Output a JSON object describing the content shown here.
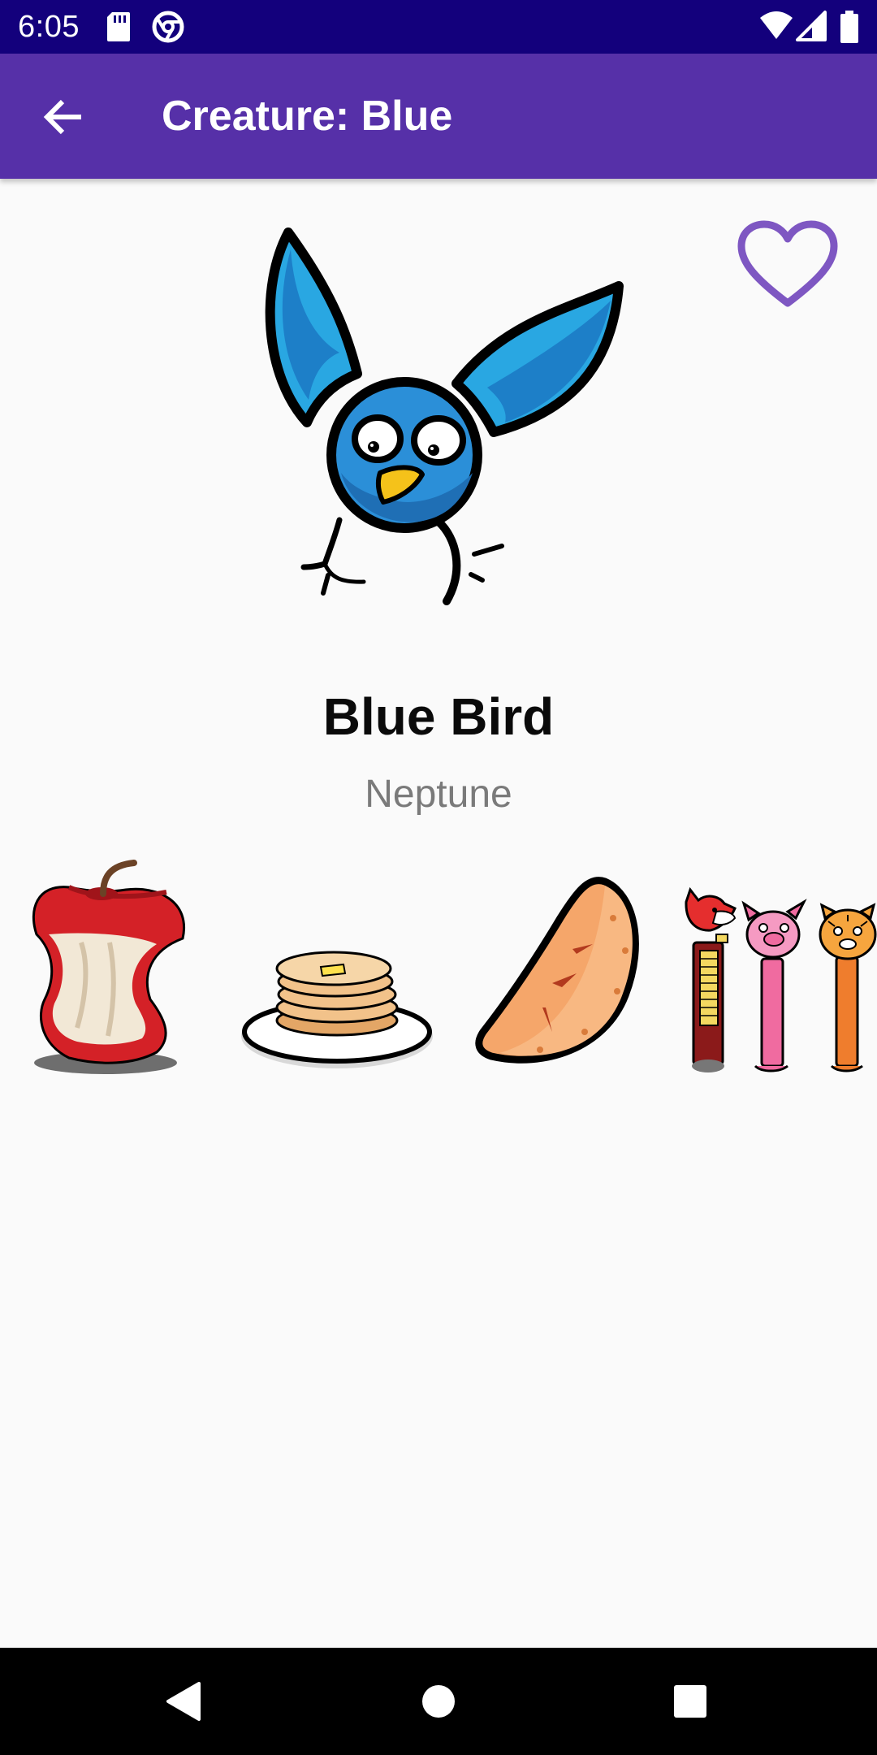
{
  "status_bar": {
    "time": "6:05",
    "icons": [
      "sd-card-icon",
      "chrome-icon",
      "wifi-icon",
      "cell-signal-icon",
      "battery-icon"
    ]
  },
  "app_bar": {
    "title": "Creature: Blue",
    "back_icon": "arrow-back-icon"
  },
  "creature": {
    "name": "Blue Bird",
    "planet": "Neptune",
    "image_icon": "blue-bird-illustration",
    "favorite_icon": "heart-outline-icon"
  },
  "foods": [
    {
      "icon": "apple-core-icon"
    },
    {
      "icon": "pancakes-icon"
    },
    {
      "icon": "pie-slice-icon"
    },
    {
      "icon": "candy-dispensers-icon"
    }
  ],
  "nav_bar": {
    "icons": [
      "back-triangle-icon",
      "home-circle-icon",
      "recents-square-icon"
    ]
  },
  "colors": {
    "status_bar": "#13007c",
    "app_bar": "#5630a8",
    "accent": "#7e57c2",
    "background": "#fafafa"
  }
}
